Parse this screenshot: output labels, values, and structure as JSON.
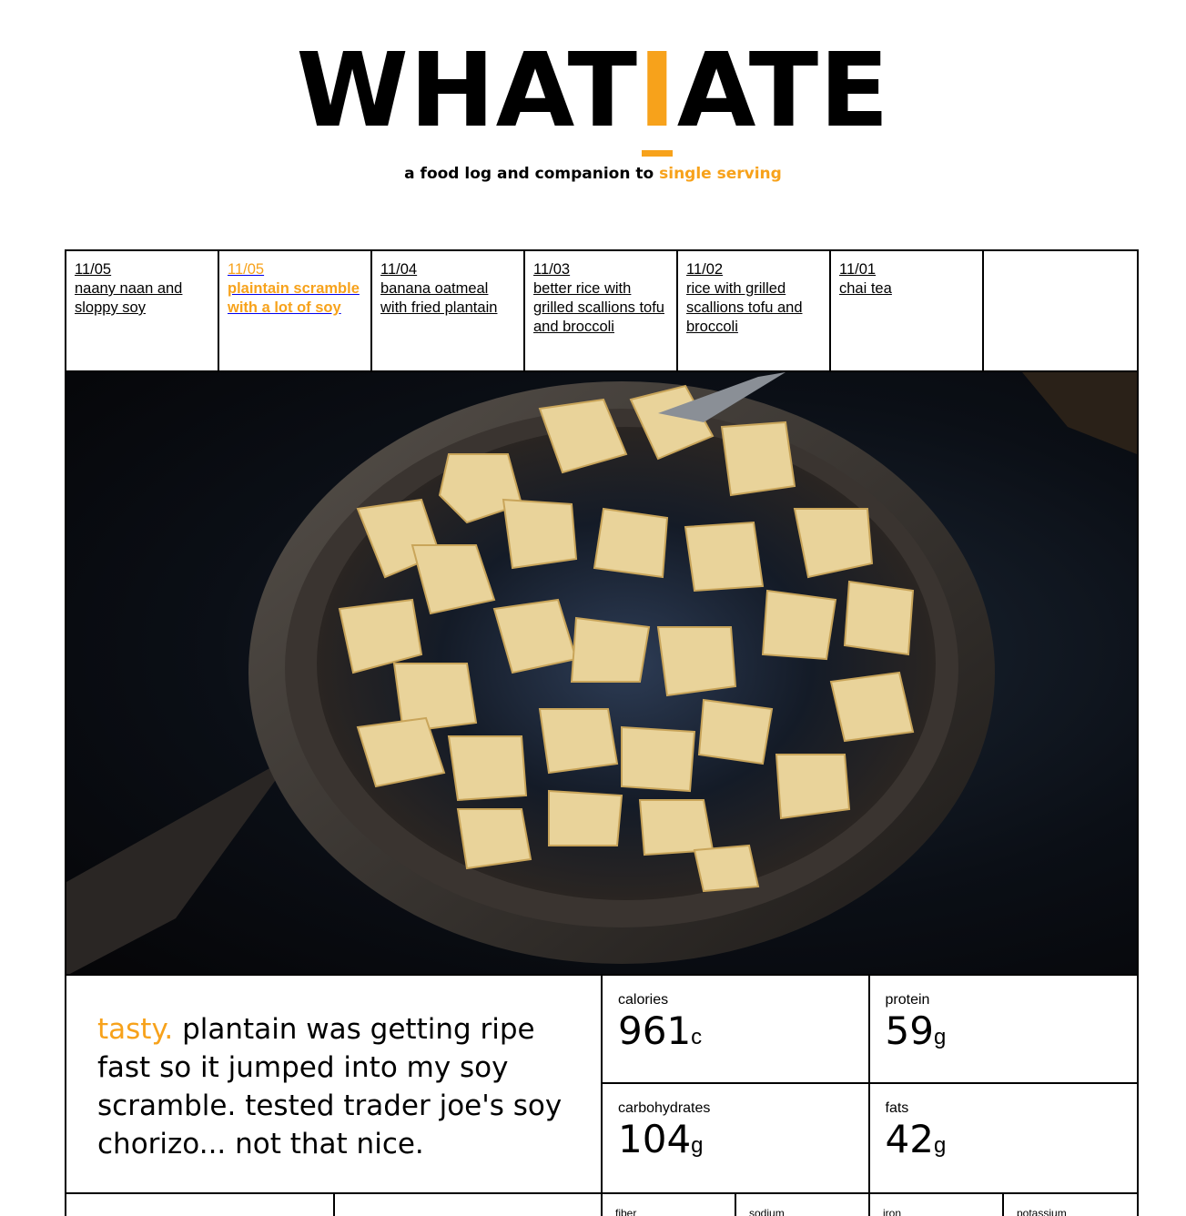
{
  "logo": {
    "before": "WHAT",
    "highlight": "I",
    "after": "ATE"
  },
  "tagline": {
    "text": "a food log and companion to",
    "link": "single serving"
  },
  "tabs": [
    {
      "date": "11/05",
      "title": "naany naan and sloppy soy",
      "active": false
    },
    {
      "date": "11/05",
      "title": "plaintain scramble with a lot of soy",
      "active": true
    },
    {
      "date": "11/04",
      "title": "banana oatmeal with fried plantain",
      "active": false
    },
    {
      "date": "11/03",
      "title": "better rice with grilled scallions tofu and broccoli",
      "active": false
    },
    {
      "date": "11/02",
      "title": "rice with grilled scallions tofu and broccoli",
      "active": false
    },
    {
      "date": "11/01",
      "title": "chai tea",
      "active": false
    }
  ],
  "note": {
    "lead": "tasty.",
    "body": "plantain was getting ripe fast so it jumped into my soy scramble. tested trader joe's soy chorizo... not that nice."
  },
  "macros": [
    {
      "label": "calories",
      "value": "961",
      "unit": "c"
    },
    {
      "label": "protein",
      "value": "59",
      "unit": "g"
    },
    {
      "label": "carbohydrates",
      "value": "104",
      "unit": "g"
    },
    {
      "label": "fats",
      "value": "42",
      "unit": "g"
    }
  ],
  "bottom": [
    {
      "label": "",
      "size": "wide"
    },
    {
      "label": "",
      "size": "wide2"
    },
    {
      "label": "fiber",
      "size": "small"
    },
    {
      "label": "sodium",
      "size": "small"
    },
    {
      "label": "iron",
      "size": "small"
    },
    {
      "label": "potassium",
      "size": "small"
    }
  ],
  "colors": {
    "accent": "#f7a21b",
    "text": "#000000"
  }
}
